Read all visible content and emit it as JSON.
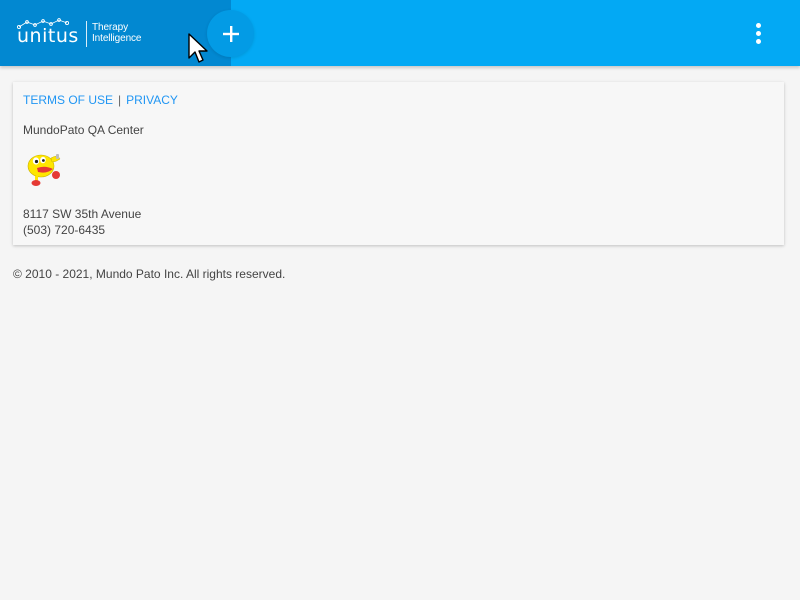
{
  "header": {
    "logo_text": "unitus",
    "logo_tagline_line1": "Therapy",
    "logo_tagline_line2": "Intelligence",
    "add_icon": "plus-icon",
    "menu_icon": "more-vertical-icon",
    "colors": {
      "header_bg": "#03a9f4",
      "brand_bg": "#0288d1",
      "fab_bg": "#039be5"
    }
  },
  "footer_card": {
    "links": {
      "terms": "TERMS OF USE",
      "separator": "|",
      "privacy": "PRIVACY"
    },
    "organization": "MundoPato QA Center",
    "mascot_icon": "duck-mascot-icon",
    "address_line": "8117 SW 35th Avenue",
    "phone": "(503) 720-6435",
    "colors": {
      "link": "#2196f3"
    }
  },
  "copyright": "© 2010 - 2021, Mundo Pato Inc. All rights reserved."
}
